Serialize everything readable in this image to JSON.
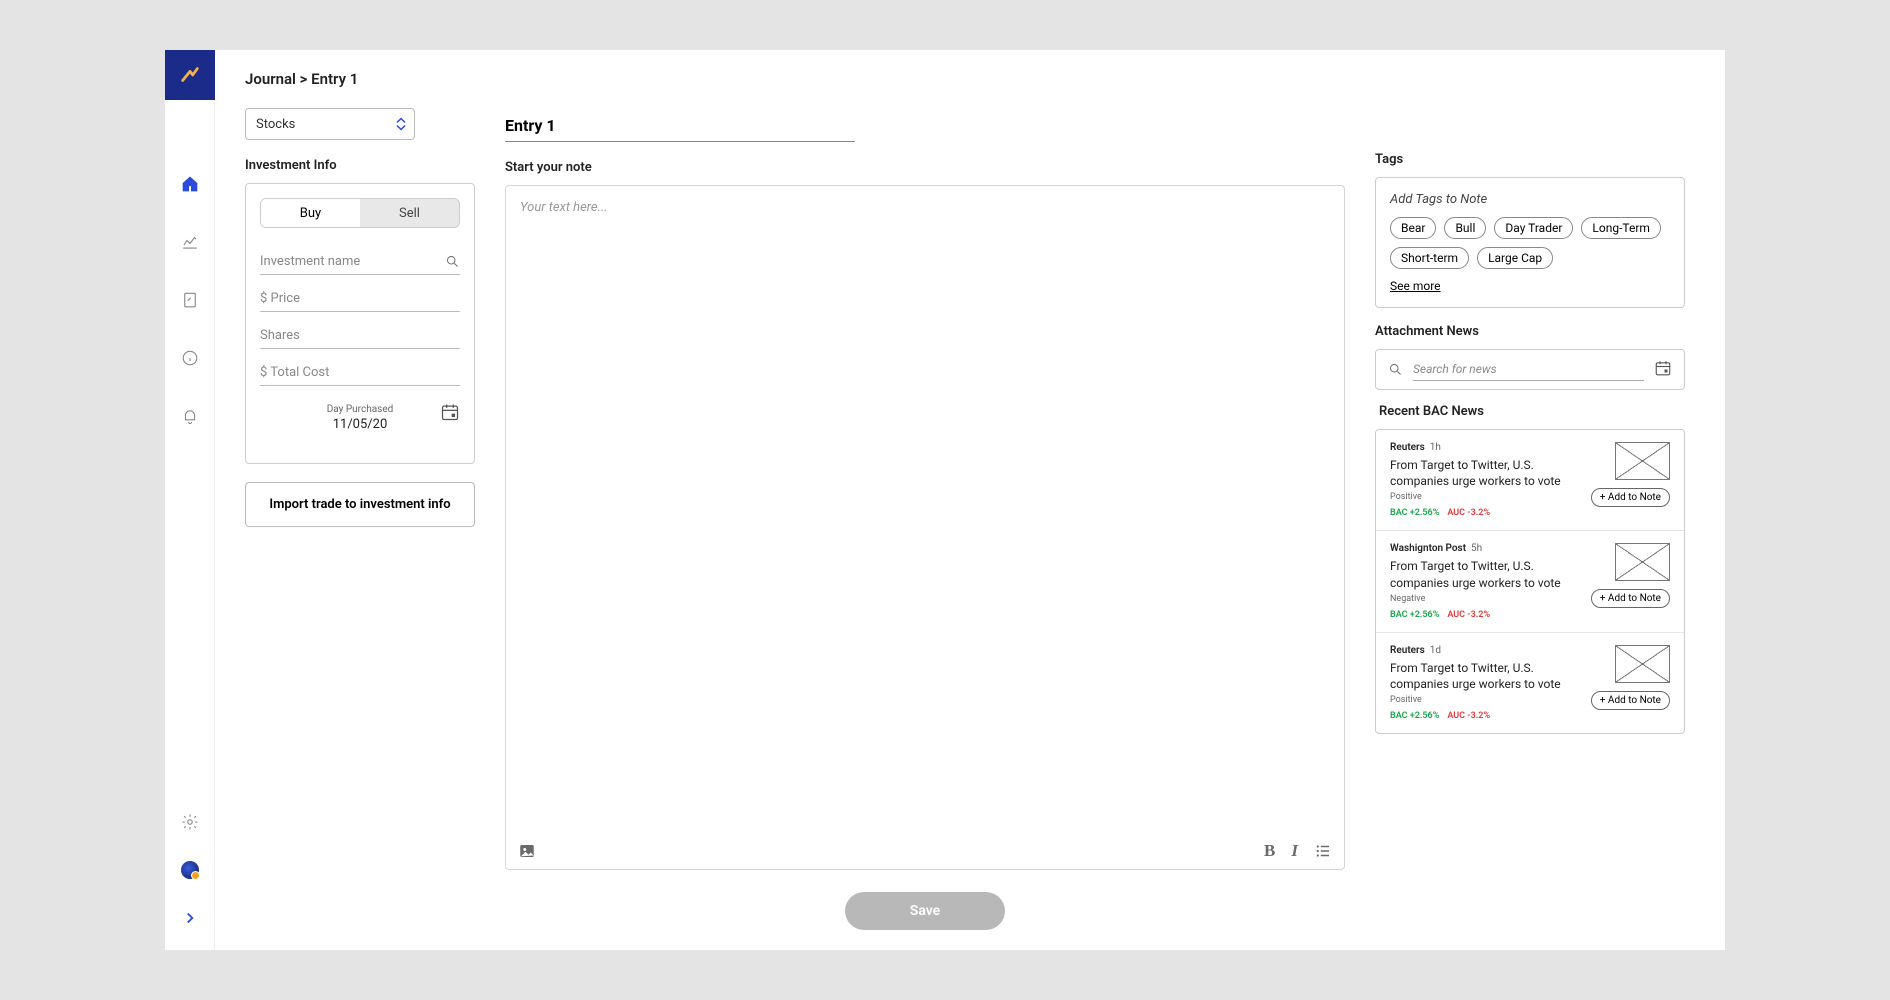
{
  "breadcrumb": "Journal > Entry 1",
  "investment_type": {
    "selected": "Stocks"
  },
  "investment_info": {
    "title": "Investment Info",
    "tabs": {
      "buy": "Buy",
      "sell": "Sell"
    },
    "fields": {
      "name_placeholder": "Investment name",
      "price_placeholder": "$ Price",
      "shares_placeholder": "Shares",
      "total_placeholder": "$ Total Cost",
      "date_label": "Day Purchased",
      "date_value": "11/05/20"
    },
    "import_btn": "Import trade to investment info"
  },
  "entry": {
    "title_value": "Entry 1",
    "note_label": "Start your note",
    "placeholder": "Your text here...",
    "save": "Save"
  },
  "tags": {
    "title": "Tags",
    "hint": "Add Tags to Note",
    "items": [
      "Bear",
      "Bull",
      "Day Trader",
      "Long-Term",
      "Short-term",
      "Large Cap"
    ],
    "see_more": "See more"
  },
  "news": {
    "attach_title": "Attachment News",
    "search_placeholder": "Search for news",
    "recent_title": "Recent BAC News",
    "add_btn": "+ Add to Note",
    "items": [
      {
        "source": "Reuters",
        "age": "1h",
        "headline": "From Target to Twitter, U.S. companies urge workers to vote",
        "sentiment": "Positive",
        "t1": "BAC +2.56%",
        "t2": "AUC -3.2%"
      },
      {
        "source": "Washignton Post",
        "age": "5h",
        "headline": "From Target to Twitter, U.S. companies urge workers to vote",
        "sentiment": "Negative",
        "t1": "BAC +2.56%",
        "t2": "AUC -3.2%"
      },
      {
        "source": "Reuters",
        "age": "1d",
        "headline": "From Target to Twitter, U.S. companies urge workers to vote",
        "sentiment": "Positive",
        "t1": "BAC +2.56%",
        "t2": "AUC -3.2%"
      }
    ]
  }
}
